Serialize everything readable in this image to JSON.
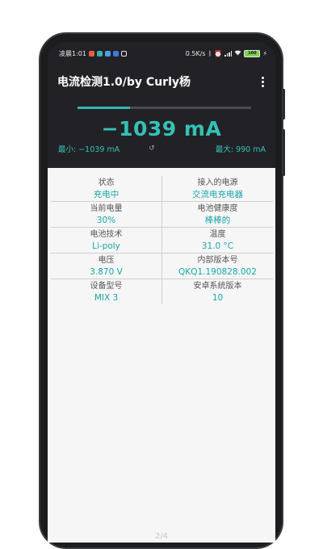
{
  "status_bar": {
    "time": "凌晨1:01",
    "notification_icons": [
      {
        "name": "app-notification-icon-orange",
        "color": "#e8613c"
      },
      {
        "name": "app-notification-icon-teal",
        "color": "#3ab0b0"
      },
      {
        "name": "app-notification-icon-blue",
        "color": "#4e9de6"
      },
      {
        "name": "app-notification-icon-blue2",
        "color": "#3f7ad9"
      },
      {
        "name": "gallery-notification-icon",
        "color": "#ffffff"
      }
    ],
    "net_speed": "0.5K/s",
    "battery_level": "100"
  },
  "app_bar": {
    "title": "电流检测1.0/by Curly杨"
  },
  "meter": {
    "current": "−1039 mA",
    "min_label": "最小: −1039 mA",
    "max_label": "最大: 990 mA",
    "progress_fraction": 0.3,
    "accent_color": "#35c1b6"
  },
  "info": {
    "rows": [
      {
        "left": {
          "label": "状态",
          "value": "充电中"
        },
        "right": {
          "label": "接入的电源",
          "value": "交流电充电器"
        }
      },
      {
        "left": {
          "label": "当前电量",
          "value": "30%"
        },
        "right": {
          "label": "电池健康度",
          "value": "棒棒的"
        }
      },
      {
        "left": {
          "label": "电池技术",
          "value": "Li-poly"
        },
        "right": {
          "label": "温度",
          "value": "31.0 °C"
        }
      },
      {
        "left": {
          "label": "电压",
          "value": "3.870 V"
        },
        "right": {
          "label": "内部版本号",
          "value": "QKQ1.190828.002"
        }
      },
      {
        "left": {
          "label": "设备型号",
          "value": "MIX 3"
        },
        "right": {
          "label": "安卓系统版本",
          "value": "10"
        }
      }
    ]
  },
  "page_indicator": "2/4"
}
